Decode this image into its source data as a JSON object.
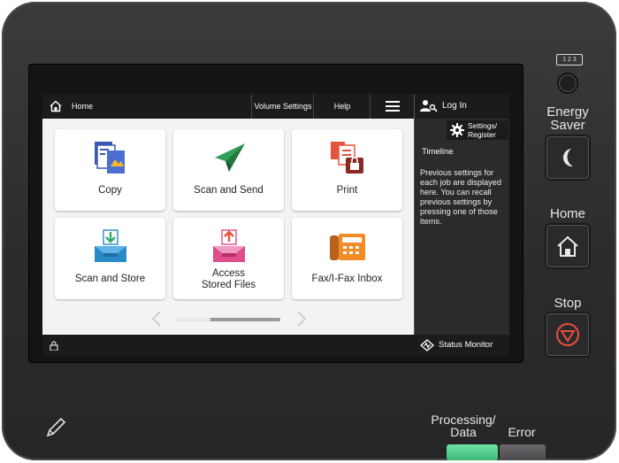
{
  "topbar": {
    "home_label": "Home",
    "volume_label": "Volume Settings",
    "help_label": "Help"
  },
  "right_panel": {
    "login_label": "Log In",
    "settings_label_1": "Settings/",
    "settings_label_2": "Register",
    "timeline_title": "Timeline",
    "timeline_text": "Previous settings for each job are displayed here. You can recall previous settings by pressing one of those items."
  },
  "tiles": [
    {
      "label": "Copy"
    },
    {
      "label": "Scan and Send"
    },
    {
      "label": "Print"
    },
    {
      "label": "Scan and Store"
    },
    {
      "label_1": "Access",
      "label_2": "Stored Files"
    },
    {
      "label": "Fax/I-Fax Inbox"
    }
  ],
  "status_monitor_label": "Status Monitor",
  "hardware": {
    "counter_label": "1 2 3",
    "energy_saver_1": "Energy",
    "energy_saver_2": "Saver",
    "home_label": "Home",
    "stop_label": "Stop",
    "processing_1": "Processing/",
    "processing_2": "Data",
    "error_label": "Error"
  },
  "colors": {
    "processing_led": "#4fcf8a",
    "stop_ring": "#e8503a"
  }
}
